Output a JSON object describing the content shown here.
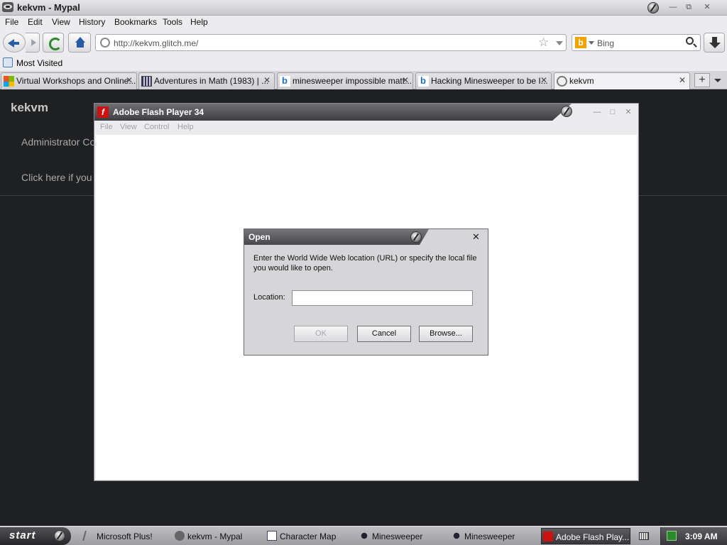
{
  "window": {
    "title": "kekvm - Mypal"
  },
  "menubar": {
    "items": [
      "File",
      "Edit",
      "View",
      "History",
      "Bookmarks",
      "Tools",
      "Help"
    ]
  },
  "navbar": {
    "url": "http://kekvm.glitch.me/",
    "search_placeholder": "Bing"
  },
  "bookmarks": {
    "most_visited": "Most Visited"
  },
  "tabs": [
    {
      "label": "Virtual Workshops and Online...",
      "icon": "microsoft-icon"
    },
    {
      "label": "Adventures in Math (1983) | ...",
      "icon": "math-icon"
    },
    {
      "label": "minesweeper impossible matt...",
      "icon": "bing-icon"
    },
    {
      "label": "Hacking Minesweeper to be I...",
      "icon": "bing-icon"
    },
    {
      "label": "kekvm",
      "icon": "globe-icon",
      "active": true
    }
  ],
  "page": {
    "site_title": "kekvm",
    "admin_line": "Administrator Co",
    "click_line": "Click here if you"
  },
  "flash": {
    "title": "Adobe Flash Player 34",
    "menu": [
      "File",
      "View",
      "Control",
      "Help"
    ]
  },
  "open_dialog": {
    "title": "Open",
    "description": "Enter the World Wide Web location (URL) or specify the local file you would like to open.",
    "location_label": "Location:",
    "location_value": "",
    "ok_label": "OK",
    "cancel_label": "Cancel",
    "browse_label": "Browse..."
  },
  "taskbar": {
    "start_label": "start",
    "items": [
      {
        "label": "Microsoft Plus!",
        "icon": "plus-icon"
      },
      {
        "label": "kekvm - Mypal",
        "icon": "mypal-icon"
      },
      {
        "label": "Character Map",
        "icon": "charmap-icon"
      },
      {
        "label": "Minesweeper",
        "icon": "minesweeper-icon"
      },
      {
        "label": "Minesweeper",
        "icon": "minesweeper-icon"
      },
      {
        "label": "Adobe Flash Play...",
        "icon": "flash-icon",
        "active": true
      }
    ],
    "clock": "3:09 AM"
  },
  "colors": {
    "page_background": "#1f2022",
    "titlebar_dark": "#3e3e42",
    "flash_red": "#cc1111"
  }
}
